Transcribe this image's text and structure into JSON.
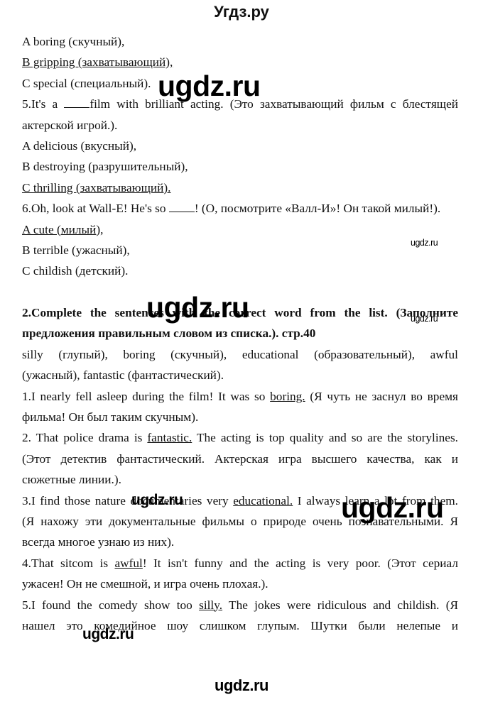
{
  "header": {
    "site_title": "Угдз.ру"
  },
  "watermarks": {
    "big1": "ugdz.ru",
    "big2": "ugdz.ru",
    "big3": "ugdz.ru",
    "small1": "ugdz.ru",
    "small2": "ugdz.ru",
    "med1": "ugdz.ru",
    "med2": "ugdz.ru",
    "footer": "ugdz.ru"
  },
  "exercise1_tail": {
    "q4_options": [
      {
        "text": "A boring (скучный),",
        "correct": false
      },
      {
        "text": "B gripping (захватывающий),",
        "correct": true
      },
      {
        "text": "C special (специальный).",
        "correct": false
      }
    ],
    "q5": {
      "prefix": "5.It's a ",
      "suffix": "film with brilliant acting. (Это захватывающий фильм с блестящей",
      "cont": "актерской игрой.).",
      "options": [
        {
          "text": "A delicious (вкусный),",
          "correct": false
        },
        {
          "text": "B destroying (разрушительный),",
          "correct": false
        },
        {
          "text": "C thrilling (захватывающий).",
          "correct": true
        }
      ]
    },
    "q6": {
      "prefix": "6.Oh, look at Wall-E! He's so ",
      "suffix": "! (О, посмотрите «Валл-И»! Он такой милый!).",
      "options": [
        {
          "text": "A cute (милый),",
          "correct": true
        },
        {
          "text": "B terrible (ужасный),",
          "correct": false
        },
        {
          "text": "C childish (детский).",
          "correct": false
        }
      ]
    }
  },
  "exercise2": {
    "heading_line1": "2.Complete the sentences with the correct word from the list. (Заполните",
    "heading_line2": "предложения правильным словом из списка.). стр.40",
    "word_list_line1": "silly (глупый), boring (скучный), educational (образовательный), awful",
    "word_list_line2": "(ужасный), fantastic (фантастический).",
    "items": [
      {
        "before": "1.I nearly fell asleep during the film! It was so ",
        "answer": "boring.",
        "after": " (Я чуть не заснул во время",
        "cont": [
          "фильма! Он был таким скучным)."
        ]
      },
      {
        "before": "2. That police drama is ",
        "answer": "fantastic.",
        "after": " The acting is top quality and so are the storylines.",
        "cont": [
          "(Этот детектив фантастический. Актерская игра высшего качества, как и",
          "сюжетные линии.)."
        ]
      },
      {
        "before": "3.I find those nature documentaries very ",
        "answer": "educational.",
        "after": " I always learn a lot from them.",
        "cont": [
          "(Я нахожу эти документальные фильмы о природе очень познавательными. Я",
          "всегда многое узнаю из них)."
        ]
      },
      {
        "before": "4.That sitcom is ",
        "answer": "awful",
        "after": "! It isn't funny and the acting is very poor. (Этот сериал",
        "cont": [
          "ужасен! Он  не смешной, и игра очень плохая.)."
        ]
      },
      {
        "before": "5.I found the comedy show too ",
        "answer": "silly.",
        "after": " The jokes were ridiculous and childish. (Я",
        "cont": [
          "нашел это комедийное шоу слишком глупым.  Шутки были нелепые и"
        ]
      }
    ]
  }
}
